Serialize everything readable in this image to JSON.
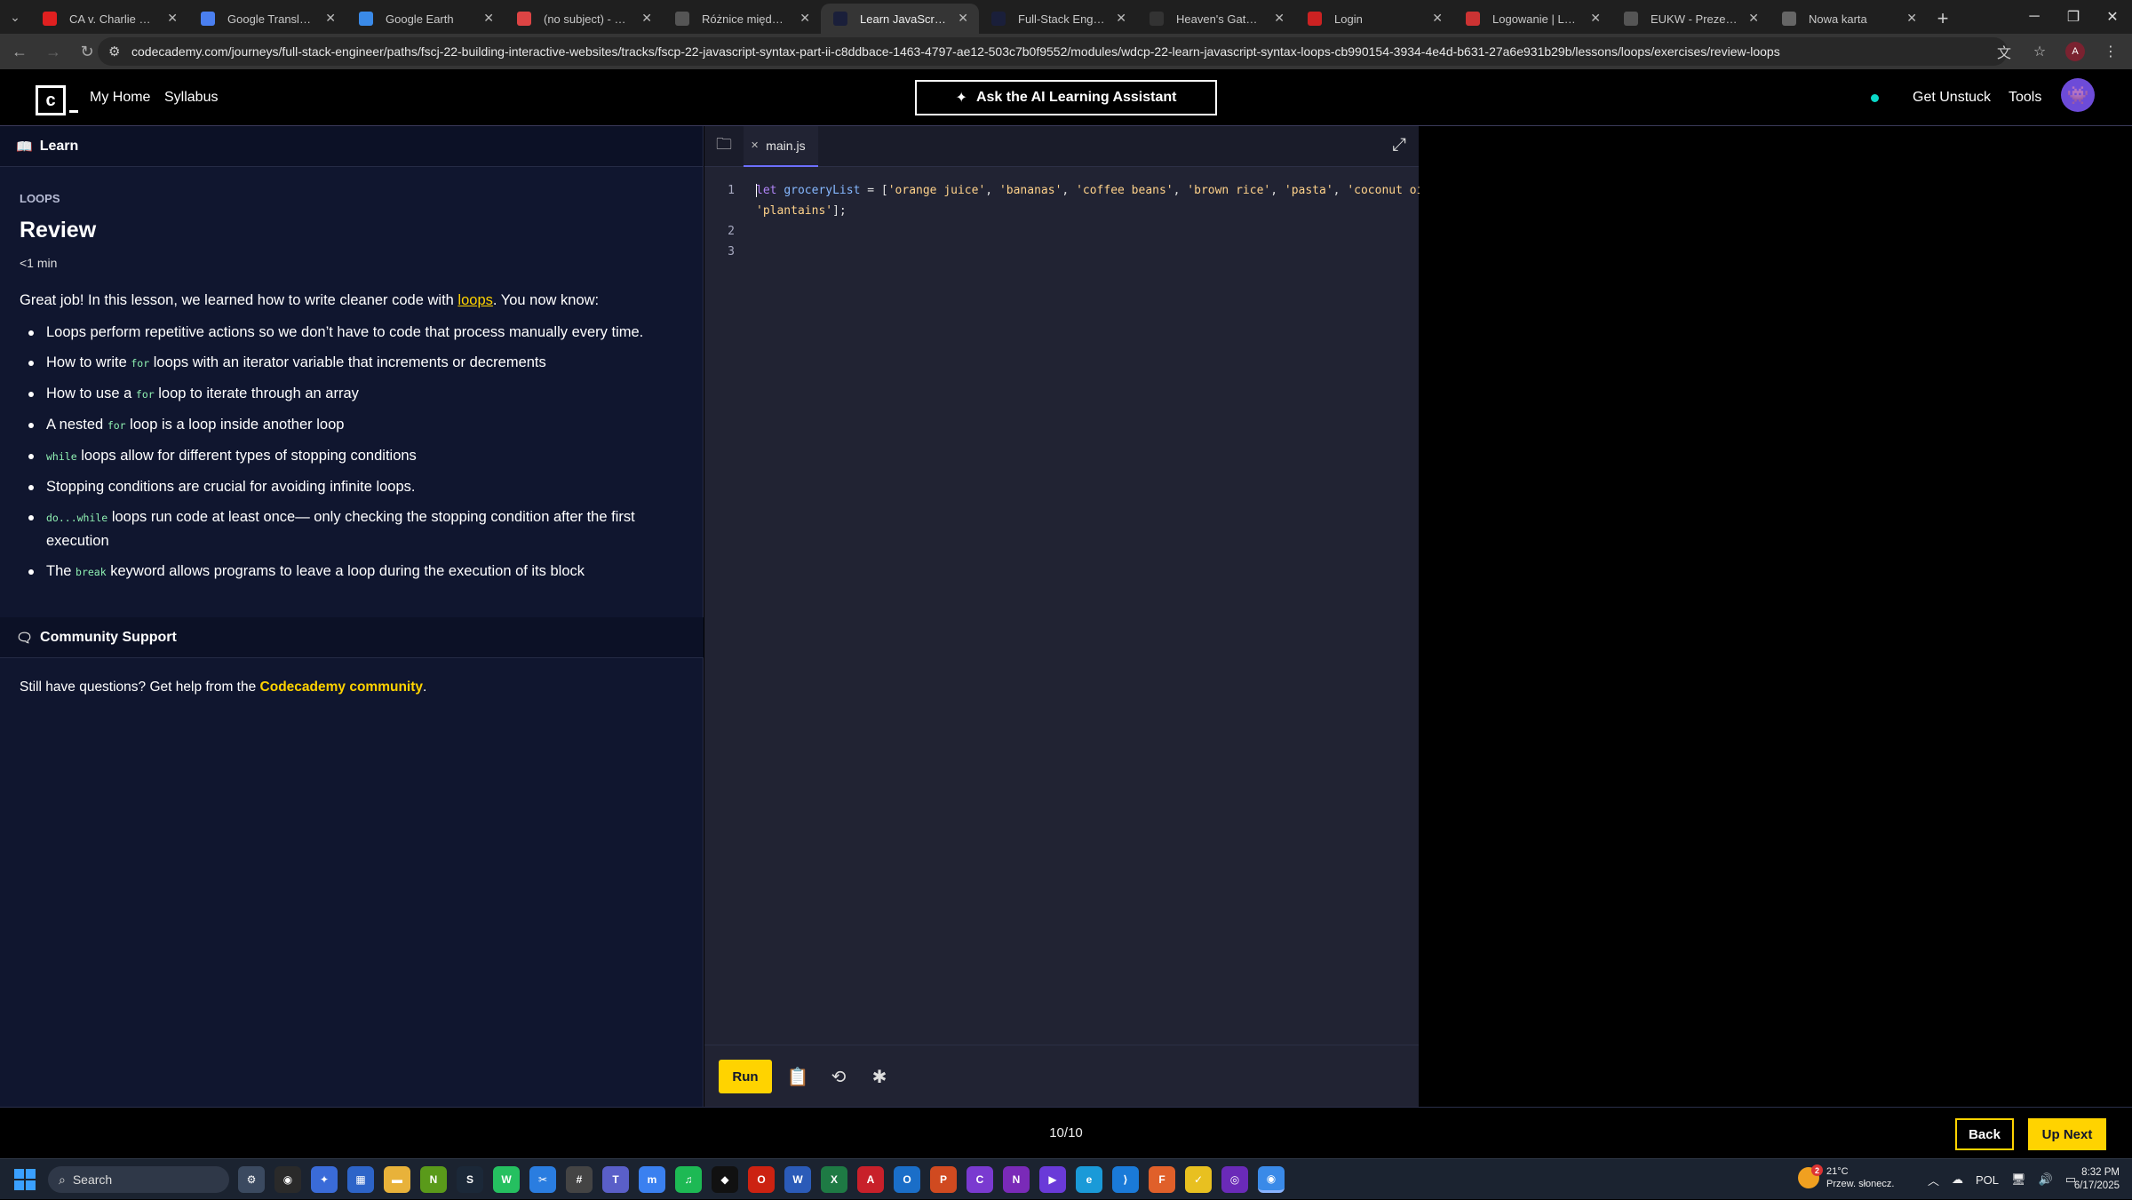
{
  "browser": {
    "tabs": [
      {
        "title": "CA v. Charlie Manson",
        "icon": "youtube-icon",
        "color": "#e02020"
      },
      {
        "title": "Google Translate",
        "icon": "translate-icon",
        "color": "#4a7ff0"
      },
      {
        "title": "Google Earth",
        "icon": "earth-icon",
        "color": "#3a8ae8"
      },
      {
        "title": "(no subject) - antoni.h",
        "icon": "gmail-icon",
        "color": "#d44"
      },
      {
        "title": "Różnice między for i w",
        "icon": "openai-icon",
        "color": "#555"
      },
      {
        "title": "Learn JavaScript Synta",
        "icon": "codecademy-icon",
        "color": "#1a1f3a"
      },
      {
        "title": "Full-Stack Engineer | C",
        "icon": "codecademy-icon",
        "color": "#1a1f3a"
      },
      {
        "title": "Heaven's Gate - How d",
        "icon": "article-icon",
        "color": "#333"
      },
      {
        "title": "Login",
        "icon": "login-icon",
        "color": "#c22"
      },
      {
        "title": "Logowanie | Login.gov",
        "icon": "gov-icon",
        "color": "#c33"
      },
      {
        "title": "EUKW - Prezentacja K",
        "icon": "eukw-icon",
        "color": "#555"
      },
      {
        "title": "Nowa karta",
        "icon": "chrome-icon",
        "color": "#666"
      }
    ],
    "url": "codecademy.com/journeys/full-stack-engineer/paths/fscj-22-building-interactive-websites/tracks/fscp-22-javascript-syntax-part-ii-c8ddbace-1463-4797-ae12-503c7b0f9552/modules/wdcp-22-learn-javascript-syntax-loops-cb990154-3934-4e4d-b631-27a6e931b29b/lessons/loops/exercises/review-loops",
    "profile_initial": "A"
  },
  "topnav": {
    "home": "My Home",
    "syllabus": "Syllabus",
    "ai_button": "Ask the AI Learning Assistant",
    "get_unstuck": "Get Unstuck",
    "tools": "Tools"
  },
  "learn": {
    "header": "Learn",
    "kicker": "LOOPS",
    "title": "Review",
    "time": "<1 min",
    "intro_before": "Great job! In this lesson, we learned how to write cleaner code with ",
    "intro_link": "loops",
    "intro_after": ". You now know:",
    "bullets": [
      {
        "pre": "Loops perform repetitive actions so we don’t have to code that process manually every time.",
        "code": "",
        "post": ""
      },
      {
        "pre": "How to write ",
        "code": "for",
        "post": " loops with an iterator variable that increments or decrements"
      },
      {
        "pre": "How to use a ",
        "code": "for",
        "post": " loop to iterate through an array"
      },
      {
        "pre": "A nested ",
        "code": "for",
        "post": " loop is a loop inside another loop"
      },
      {
        "pre": "",
        "code": "while",
        "post": " loops allow for different types of stopping conditions"
      },
      {
        "pre": "Stopping conditions are crucial for avoiding infinite loops.",
        "code": "",
        "post": ""
      },
      {
        "pre": "",
        "code": "do...while",
        "post": " loops run code at least once— only checking the stopping condition after the first execution"
      },
      {
        "pre": "The ",
        "code": "break",
        "post": " keyword allows programs to leave a loop during the execution of its block"
      }
    ]
  },
  "community": {
    "header": "Community Support",
    "text": "Still have questions? Get help from the ",
    "link": "Codecademy community",
    "end": "."
  },
  "editor": {
    "filename": "main.js",
    "line_numbers": [
      "1",
      "2",
      "3"
    ],
    "code": {
      "kw": "let",
      "var": "groceryList",
      "op": " = [",
      "items": [
        "'orange juice'",
        "'bananas'",
        "'coffee beans'",
        "'brown rice'",
        "'pasta'",
        "'coconut oil'"
      ],
      "last": "'plantains'",
      "end": "];"
    },
    "run_label": "Run"
  },
  "footer": {
    "progress": "10/10",
    "back": "Back",
    "next": "Up Next"
  },
  "taskbar": {
    "search_placeholder": "Search",
    "weather_temp": "21°C",
    "weather_desc": "Przew. słonecz.",
    "weather_badge": "2",
    "lang": "POL",
    "time": "8:32 PM",
    "date": "6/17/2025",
    "apps": [
      {
        "icon": "settings-icon",
        "color": "#3b4a60",
        "glyph": "⚙"
      },
      {
        "icon": "obs-icon",
        "color": "#2a2a2a",
        "glyph": "◉"
      },
      {
        "icon": "copilot-icon",
        "color": "#3a6bd8",
        "glyph": "✦"
      },
      {
        "icon": "store-icon",
        "color": "#2d64c8",
        "glyph": "▦"
      },
      {
        "icon": "folder-icon",
        "color": "#e8b23a",
        "glyph": "▬"
      },
      {
        "icon": "nvidia-icon",
        "color": "#5a9a1a",
        "glyph": "N"
      },
      {
        "icon": "steam-icon",
        "color": "#1b2838",
        "glyph": "S"
      },
      {
        "icon": "whatsapp-icon",
        "color": "#25c060",
        "glyph": "W"
      },
      {
        "icon": "snip-icon",
        "color": "#2a7de0",
        "glyph": "✂"
      },
      {
        "icon": "calculator-icon",
        "color": "#444",
        "glyph": "#"
      },
      {
        "icon": "teams-icon",
        "color": "#5a5fc8",
        "glyph": "T"
      },
      {
        "icon": "messenger-icon",
        "color": "#3a80f0",
        "glyph": "m"
      },
      {
        "icon": "spotify-icon",
        "color": "#1db954",
        "glyph": "♫"
      },
      {
        "icon": "tidal-icon",
        "color": "#111",
        "glyph": "◆"
      },
      {
        "icon": "opera-icon",
        "color": "#c21",
        "glyph": "O"
      },
      {
        "icon": "word-icon",
        "color": "#2b5bb8",
        "glyph": "W"
      },
      {
        "icon": "excel-icon",
        "color": "#1e7a44",
        "glyph": "X"
      },
      {
        "icon": "acrobat-icon",
        "color": "#c8202a",
        "glyph": "A"
      },
      {
        "icon": "outlook-icon",
        "color": "#1a6ec8",
        "glyph": "O"
      },
      {
        "icon": "powerpoint-icon",
        "color": "#d04a20",
        "glyph": "P"
      },
      {
        "icon": "clipchamp-icon",
        "color": "#7a3ad0",
        "glyph": "C"
      },
      {
        "icon": "onenote-icon",
        "color": "#7a2ab8",
        "glyph": "N"
      },
      {
        "icon": "video-editor-icon",
        "color": "#6a3ad8",
        "glyph": "▶"
      },
      {
        "icon": "edge-icon",
        "color": "#1a9ad8",
        "glyph": "e"
      },
      {
        "icon": "vscode-icon",
        "color": "#1a7ad8",
        "glyph": "⟩"
      },
      {
        "icon": "firefox-icon",
        "color": "#e0602a",
        "glyph": "F"
      },
      {
        "icon": "tasks-icon",
        "color": "#e8c020",
        "glyph": "✓"
      },
      {
        "icon": "tor-icon",
        "color": "#6a2ab8",
        "glyph": "◎"
      },
      {
        "icon": "chrome-icon",
        "color": "#3a8ae8",
        "glyph": "◉"
      }
    ]
  }
}
